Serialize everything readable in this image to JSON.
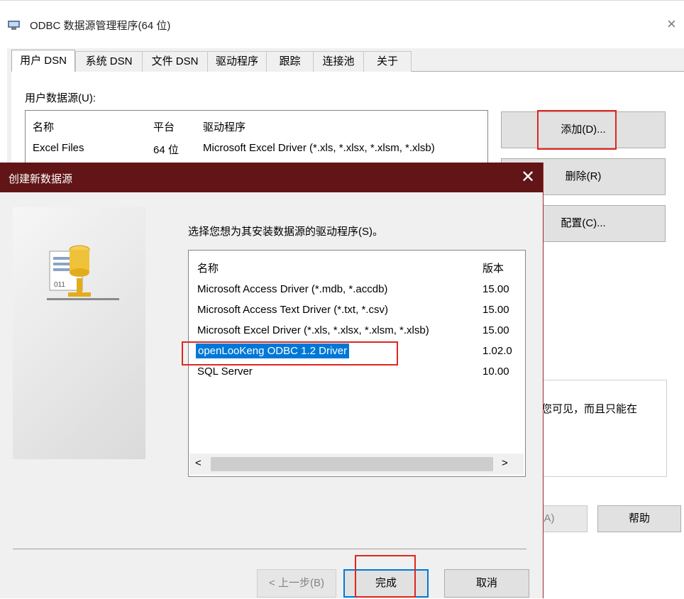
{
  "odbc": {
    "title": "ODBC 数据源管理程序(64 位)",
    "close": "×",
    "tabs": [
      "用户 DSN",
      "系统 DSN",
      "文件 DSN",
      "驱动程序",
      "跟踪",
      "连接池",
      "关于"
    ],
    "user_ds_label": "用户数据源(U):",
    "columns": [
      "名称",
      "平台",
      "驱动程序"
    ],
    "rows": [
      {
        "name": "Excel Files",
        "platform": "64 位",
        "driver": "Microsoft Excel Driver (*.xls, *.xlsx, *.xlsm, *.xlsb)"
      }
    ],
    "buttons": {
      "add": "添加(D)...",
      "remove": "删除(R)",
      "configure": "配置(C)...",
      "apply_partial": "用(A)",
      "help": "帮助"
    },
    "description_partial": "您可见，而且只能在"
  },
  "dialog": {
    "title": "创建新数据源",
    "close": "✕",
    "prompt": "选择您想为其安装数据源的驱动程序(S)。",
    "columns": [
      "名称",
      "版本"
    ],
    "drivers": [
      {
        "name": "Microsoft Access Driver (*.mdb, *.accdb)",
        "version": "15.00"
      },
      {
        "name": "Microsoft Access Text Driver (*.txt, *.csv)",
        "version": "15.00"
      },
      {
        "name": "Microsoft Excel Driver (*.xls, *.xlsx, *.xlsm, *.xlsb)",
        "version": "15.00"
      },
      {
        "name": "openLooKeng ODBC 1.2 Driver",
        "version": "1.02.0",
        "selected": true
      },
      {
        "name": "SQL Server",
        "version": "10.00"
      }
    ],
    "scroll_left": "<",
    "scroll_right": ">",
    "buttons": {
      "back": "< 上一步(B)",
      "finish": "完成",
      "cancel": "取消"
    }
  },
  "colors": {
    "dialog_title": "#611516",
    "selection": "#0078d7",
    "highlight_box": "#e0261f"
  }
}
